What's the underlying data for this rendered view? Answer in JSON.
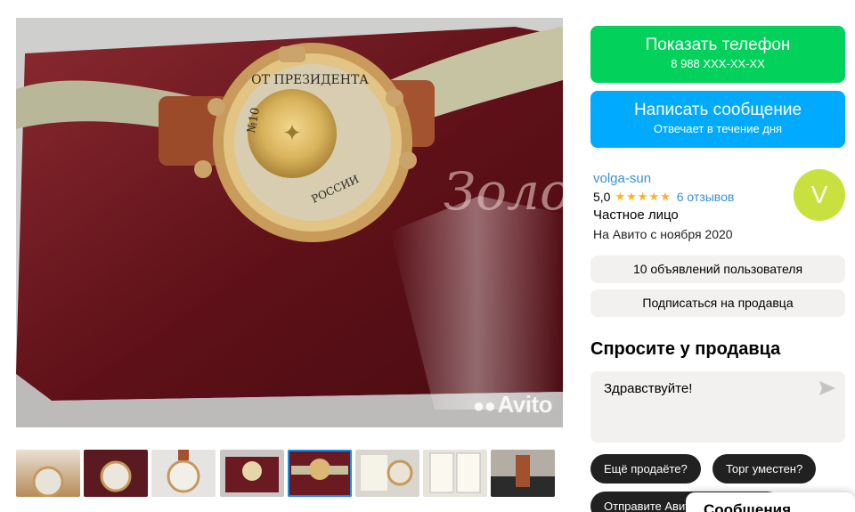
{
  "gallery": {
    "watermark": "Avito",
    "box_text": "Золотое Время",
    "caseback_text": "ОТ ПРЕЗИДЕНТА РОССИИ",
    "caseback_number": "№10",
    "thumbnail_count": 8,
    "active_thumbnail_index": 4
  },
  "contact": {
    "show_phone_label": "Показать телефон",
    "phone_masked": "8 988 XXX-XX-XX",
    "write_message_label": "Написать сообщение",
    "response_time": "Отвечает в течение дня"
  },
  "seller": {
    "name": "volga-sun",
    "rating": "5,0",
    "stars": "★★★★★",
    "reviews": "6 отзывов",
    "type": "Частное лицо",
    "since": "На Авито с ноября 2020",
    "avatar_letter": "V",
    "listings_label": "10 объявлений пользователя",
    "subscribe_label": "Подписаться на продавца"
  },
  "ask": {
    "title": "Спросите у продавца",
    "message_value": "Здравствуйте!",
    "quick_replies": [
      "Ещё продаёте?",
      "Торг уместен?",
      "Отправите Авито Доставкой?"
    ]
  },
  "messenger": {
    "title": "Сообщения"
  },
  "colors": {
    "green": "#02d15c",
    "blue": "#00aaff",
    "link": "#3a91d6",
    "star": "#ffb021",
    "avatar": "#c8e13f"
  }
}
